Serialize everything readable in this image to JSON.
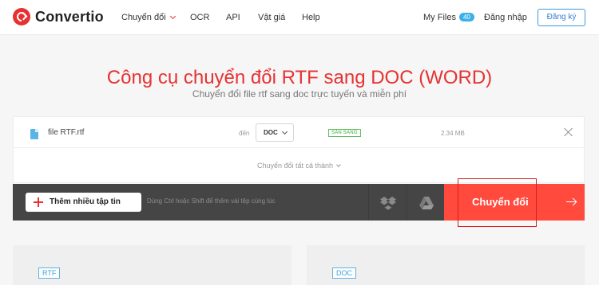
{
  "header": {
    "brand": "Convertio",
    "nav": {
      "convert": "Chuyển đổi",
      "ocr": "OCR",
      "api": "API",
      "pricing": "Vật giá",
      "help": "Help"
    },
    "my_files": "My Files",
    "my_files_count": "40",
    "login": "Đăng nhập",
    "signup": "Đăng ký"
  },
  "hero": {
    "title": "Công cụ chuyển đổi RTF sang DOC (WORD)",
    "subtitle": "Chuyển đổi file rtf sang doc trực tuyến và miễn phí"
  },
  "file_row": {
    "name": "file RTF.rtf",
    "to_label": "đến",
    "target_format": "DOC",
    "status": "SẴN SÀNG",
    "size": "2.34 MB"
  },
  "convert_all": "Chuyển đổi tất cả thành",
  "action_bar": {
    "add_files": "Thêm nhiều tập tin",
    "hint": "Dùng Ctrl hoặc Shift để thêm vài tệp cùng lúc",
    "convert": "Chuyển đổi"
  },
  "formats": {
    "source": "RTF",
    "target": "DOC"
  },
  "colors": {
    "accent": "#e63232",
    "convert_button": "#ff4a3d",
    "action_bar": "#454545",
    "badge": "#3bb1e8",
    "status_ready": "#3aa63a"
  },
  "icons": [
    "convertio-logo-icon",
    "chevron-down-icon",
    "file-icon",
    "close-icon",
    "plus-icon",
    "dropbox-icon",
    "google-drive-icon",
    "arrow-right-icon"
  ]
}
